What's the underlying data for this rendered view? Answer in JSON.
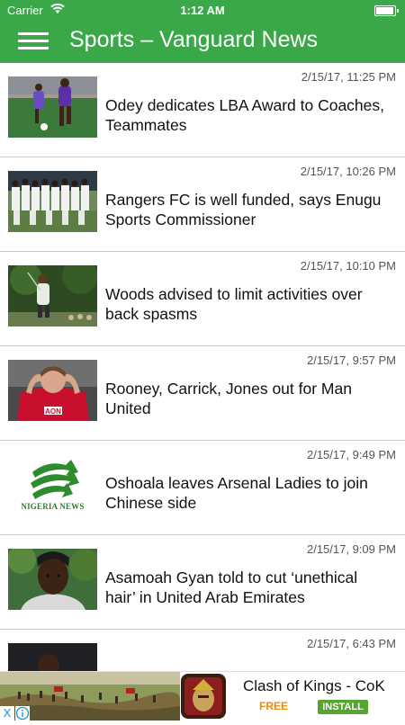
{
  "status_bar": {
    "carrier": "Carrier",
    "time": "1:12 AM"
  },
  "nav": {
    "title": "Sports – Vanguard News",
    "menu_icon": "hamburger-menu-icon"
  },
  "colors": {
    "brand_green": "#3aa848",
    "divider": "#c8c8c8",
    "ad_install_green": "#55a630",
    "ad_free_orange": "#f08a00"
  },
  "articles": [
    {
      "timestamp": "2/15/17, 11:25 PM",
      "headline": "Odey dedicates LBA Award to Coaches, Teammates",
      "thumbnail": "football-player-photo"
    },
    {
      "timestamp": "2/15/17, 10:26 PM",
      "headline": "Rangers FC is well funded, says Enugu Sports Commissioner",
      "thumbnail": "team-photo"
    },
    {
      "timestamp": "2/15/17, 10:10 PM",
      "headline": "Woods advised to limit activities over back spasms",
      "thumbnail": "golfer-photo"
    },
    {
      "timestamp": "2/15/17, 9:57 PM",
      "headline": "Rooney, Carrick, Jones out for Man United",
      "thumbnail": "rooney-photo"
    },
    {
      "timestamp": "2/15/17, 9:49 PM",
      "headline": "Oshoala leaves Arsenal Ladies to join Chinese side",
      "thumbnail": "nigeria-news-logo",
      "thumbnail_text": "NIGERIA NEWS"
    },
    {
      "timestamp": "2/15/17, 9:09 PM",
      "headline": "Asamoah Gyan told to cut ‘unethical hair’ in United Arab Emirates",
      "thumbnail": "gyan-photo"
    },
    {
      "timestamp": "2/15/17, 6:43 PM",
      "headline": "",
      "thumbnail": "player-photo"
    }
  ],
  "ad": {
    "title": "Clash of Kings - CoK",
    "price": "FREE",
    "install_label": "INSTALL",
    "close_label": "X"
  }
}
